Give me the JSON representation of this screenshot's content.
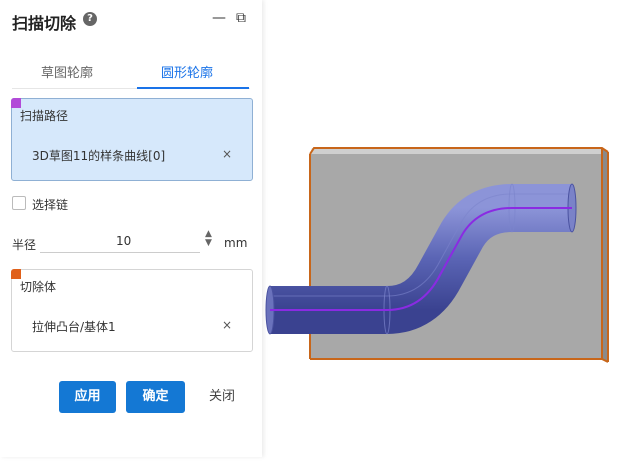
{
  "panel": {
    "title": "扫描切除",
    "minimize": "—",
    "restore": "⧉"
  },
  "tabs": [
    {
      "label": "草图轮廓"
    },
    {
      "label": "圆形轮廓"
    }
  ],
  "sweep_path": {
    "label": "扫描路径",
    "item": "3D草图11的样条曲线[0]",
    "remove": "×",
    "accent_color": "#b24ad8"
  },
  "select_chain": {
    "label": "选择链",
    "checked": false
  },
  "radius": {
    "label": "半径",
    "value": "10",
    "unit": "mm"
  },
  "cut_body": {
    "label": "切除体",
    "item": "拉伸凸台/基体1",
    "remove": "×",
    "accent_color": "#e0601a"
  },
  "buttons": {
    "apply": "应用",
    "ok": "确定",
    "close": "关闭"
  },
  "colors": {
    "accent": "#1478d4",
    "selection_edge": "#c8661a",
    "body_gray": "#a0a0a0",
    "tube_blue": "#5a64b4",
    "path_purple": "#8a2be2"
  }
}
